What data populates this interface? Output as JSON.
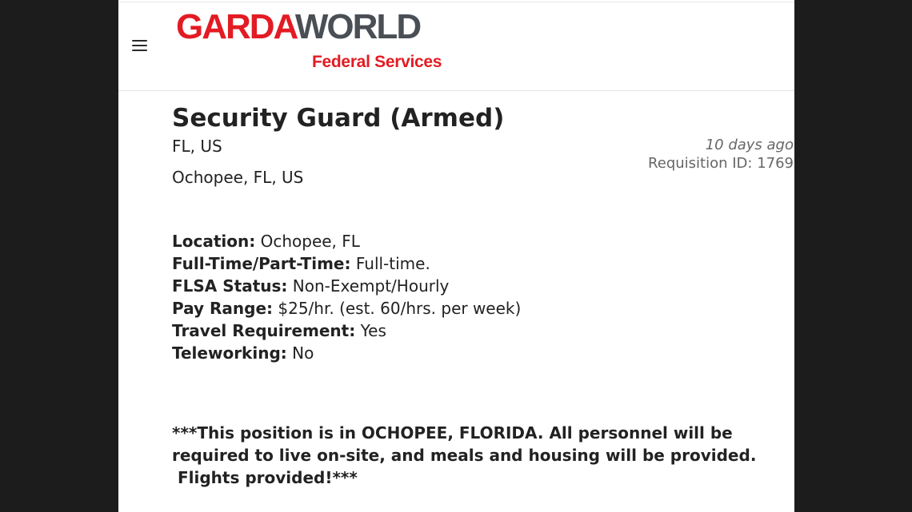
{
  "brand": {
    "logo_part1": "GARDA",
    "logo_part2": "WORLD",
    "subtitle": "Federal Services",
    "colors": {
      "red": "#e31b23",
      "gray": "#4a4f55"
    }
  },
  "header": {
    "menu_icon": "hamburger-menu-icon"
  },
  "job": {
    "title": "Security Guard (Armed)",
    "location_short": "FL, US",
    "location_full": "Ochopee, FL, US",
    "posted": "10 days ago",
    "requisition": "Requisition ID: 1769"
  },
  "details": [
    {
      "label": "Location:",
      "value": " Ochopee, FL"
    },
    {
      "label": "Full-Time/Part-Time:",
      "value": " Full-time."
    },
    {
      "label": "FLSA Status:",
      "value": " Non-Exempt/Hourly"
    },
    {
      "label": "Pay Range:",
      "value": " $25/hr. (est. 60/hrs. per week)"
    },
    {
      "label": "Travel Requirement:",
      "value": " Yes"
    },
    {
      "label": "Teleworking:",
      "value": " No"
    }
  ],
  "notice": {
    "line1": "***This position is in OCHOPEE, FLORIDA. All personnel will be",
    "line2": "required to live on-site, and meals and housing will be provided.",
    "line3": " Flights provided!***"
  }
}
